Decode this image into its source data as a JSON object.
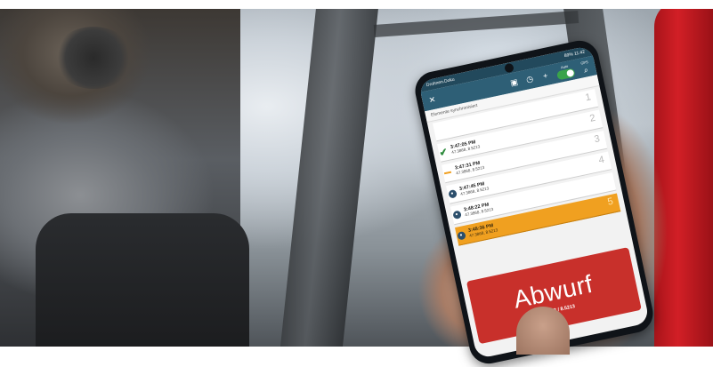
{
  "status_bar": {
    "left": "Drohnen.Doku",
    "right": "89% 11:42"
  },
  "toolbar": {
    "close_icon": "close-icon",
    "save_icon": "save-icon",
    "history_icon": "history-icon",
    "add_icon": "plus-icon",
    "auto_label": "Auto",
    "gps_label": "GPS",
    "search_icon": "search-icon"
  },
  "sync_text": "Elemente synchronisiert",
  "entries": [
    {
      "index": "1",
      "time": "",
      "coords": "",
      "marker": "none"
    },
    {
      "index": "2",
      "time": "3:47:05 PM",
      "coords": "47.3868, 8.5213",
      "marker": "check"
    },
    {
      "index": "3",
      "time": "3:47:31 PM",
      "coords": "47.3868, 8.5213",
      "marker": "bar"
    },
    {
      "index": "4",
      "time": "3:47:45 PM",
      "coords": "47.3868, 8.5213",
      "marker": "dot"
    },
    {
      "index": "",
      "time": "3:48:22 PM",
      "coords": "47.3868, 8.5213",
      "marker": "dot"
    },
    {
      "index": "5",
      "time": "3:48:36 PM",
      "coords": "47.3868, 8.5213",
      "marker": "dot",
      "active": true
    }
  ],
  "abwurf": {
    "label": "Abwurf",
    "coords": "47.3868 / 8.5213"
  },
  "colors": {
    "toolbar": "#2e5f76",
    "active_row": "#f0a020",
    "abwurf": "#c8302b",
    "check": "#2e8b3d"
  }
}
